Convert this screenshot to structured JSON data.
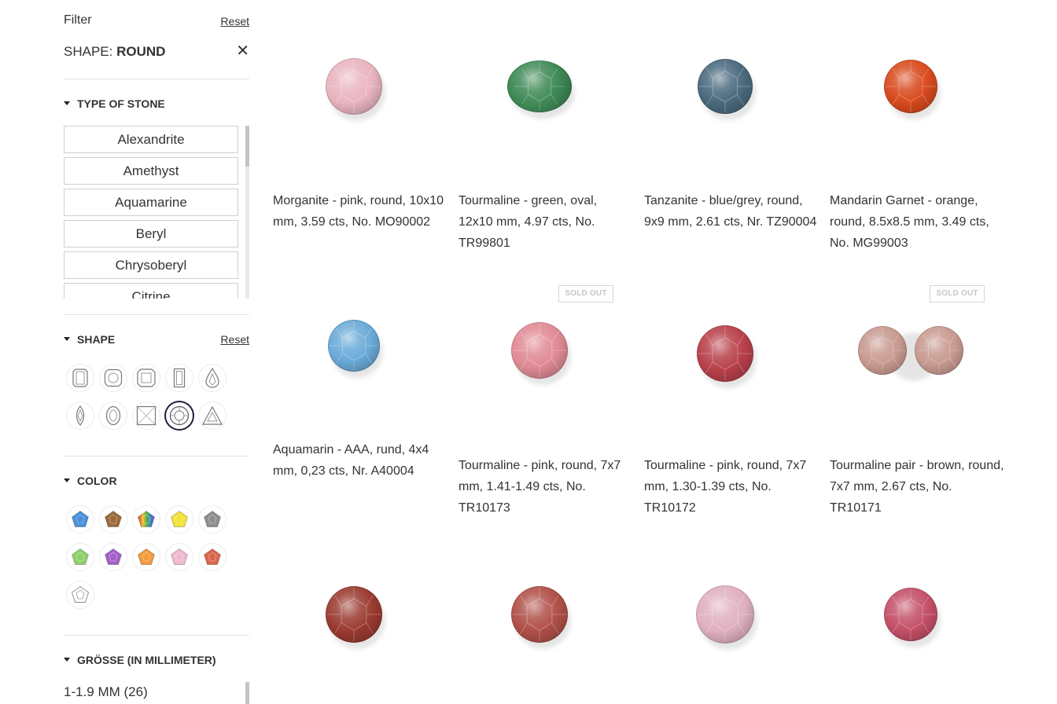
{
  "filter": {
    "title": "Filter",
    "reset": "Reset"
  },
  "active_shape": {
    "label": "SHAPE: ",
    "value": "ROUND",
    "close_icon": "close-icon"
  },
  "type_of_stone": {
    "heading": "TYPE OF STONE",
    "items": [
      "Alexandrite",
      "Amethyst",
      "Aquamarine",
      "Beryl",
      "Chrysoberyl",
      "Citrine"
    ]
  },
  "shape": {
    "heading": "SHAPE",
    "reset": "Reset",
    "icons": [
      "emerald-cut-icon",
      "cushion-cut-icon",
      "asscher-cut-icon",
      "baguette-cut-icon",
      "pear-cut-icon",
      "marquise-cut-icon",
      "oval-cut-icon",
      "princess-cut-icon",
      "round-cut-icon",
      "trillion-cut-icon"
    ],
    "selected": "round-cut-icon"
  },
  "color": {
    "heading": "COLOR",
    "swatches": [
      {
        "name": "blue",
        "hex": "#4a90d9"
      },
      {
        "name": "brown",
        "hex": "#9a6a3a"
      },
      {
        "name": "multicolor",
        "hex": "#e05050"
      },
      {
        "name": "yellow",
        "hex": "#f2e23a"
      },
      {
        "name": "grey",
        "hex": "#8e8e8e"
      },
      {
        "name": "green",
        "hex": "#8fcf6a"
      },
      {
        "name": "violet",
        "hex": "#a45fc8"
      },
      {
        "name": "orange",
        "hex": "#f39a3c"
      },
      {
        "name": "pink",
        "hex": "#f0b8d0"
      },
      {
        "name": "red",
        "hex": "#d9664a"
      },
      {
        "name": "white",
        "hex": "#ffffff"
      }
    ]
  },
  "size": {
    "heading": "GRÖSSE (IN MILLIMETER)",
    "items": [
      {
        "label": "1-1.9 MM (26)"
      }
    ]
  },
  "products": [
    {
      "name": "Morganite - pink, round, 10x10 mm, 3.59 cts, No. MO90002",
      "sold_out": false,
      "color": "#e9b4c0"
    },
    {
      "name": "Tourmaline - green, oval, 12x10 mm, 4.97 cts, No. TR99801",
      "sold_out": false,
      "color": "#3f8a56"
    },
    {
      "name": "Tanzanite - blue/grey, round, 9x9 mm, 2.61 cts, Nr. TZ90004",
      "sold_out": false,
      "color": "#4a6a7e"
    },
    {
      "name": "Mandarin Garnet - orange, round, 8.5x8.5 mm, 3.49 cts, No. MG99003",
      "sold_out": false,
      "color": "#d84a1e"
    },
    {
      "name": "Aquamarin - AAA, rund, 4x4 mm, 0,23 cts, Nr. A40004",
      "sold_out": false,
      "color": "#6aaad8"
    },
    {
      "name": "Tourmaline - pink, round, 7x7 mm, 1.41-1.49 cts, No. TR10173",
      "sold_out": true,
      "color": "#e08a94"
    },
    {
      "name": "Tourmaline - pink, round, 7x7 mm, 1.30-1.39 cts, No. TR10172",
      "sold_out": false,
      "color": "#b8404a"
    },
    {
      "name": "Tourmaline pair - brown, round, 7x7 mm, 2.67 cts, No. TR10171",
      "sold_out": true,
      "color": "#c89a90"
    },
    {
      "name": "",
      "sold_out": false,
      "color": "#9a3a30"
    },
    {
      "name": "",
      "sold_out": false,
      "color": "#b05048"
    },
    {
      "name": "",
      "sold_out": false,
      "color": "#e0b0c0"
    },
    {
      "name": "",
      "sold_out": false,
      "color": "#c45068"
    }
  ],
  "sold_out_label": "SOLD OUT"
}
